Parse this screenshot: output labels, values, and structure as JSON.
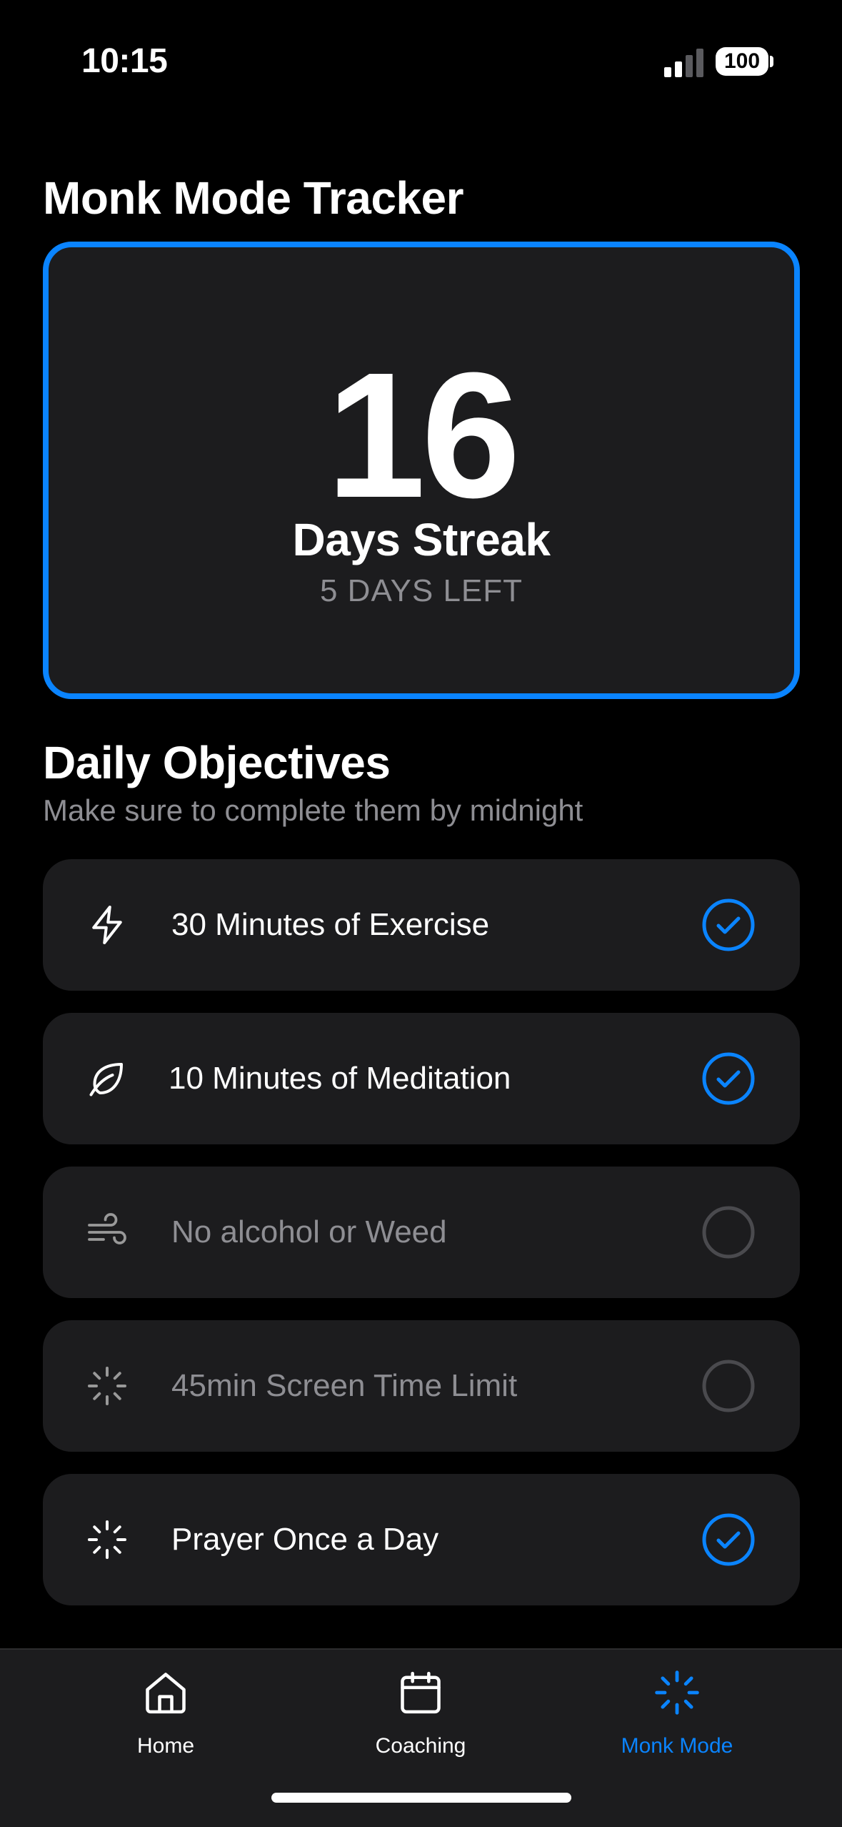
{
  "status_bar": {
    "time": "10:15",
    "battery": "100"
  },
  "page_title": "Monk Mode Tracker",
  "streak": {
    "count": "16",
    "label": "Days Streak",
    "remaining": "5 DAYS LEFT"
  },
  "objectives_section": {
    "title": "Daily Objectives",
    "subtitle": "Make sure to complete them by midnight"
  },
  "objectives": [
    {
      "label": "30 Minutes of Exercise",
      "icon": "bolt-icon",
      "completed": true
    },
    {
      "label": "10 Minutes of Meditation",
      "icon": "leaf-icon",
      "completed": true
    },
    {
      "label": "No alcohol or Weed",
      "icon": "wind-icon",
      "completed": false
    },
    {
      "label": "45min Screen Time Limit",
      "icon": "loader-icon",
      "completed": false
    },
    {
      "label": "Prayer Once a Day",
      "icon": "loader-icon",
      "completed": true
    }
  ],
  "tab_bar": {
    "tabs": [
      {
        "label": "Home",
        "icon": "home-icon",
        "active": false
      },
      {
        "label": "Coaching",
        "icon": "calendar-icon",
        "active": false
      },
      {
        "label": "Monk Mode",
        "icon": "loader-icon",
        "active": true
      }
    ]
  },
  "colors": {
    "accent": "#0a84ff",
    "card": "#1c1c1e",
    "muted": "#8e8e93",
    "background": "#000000"
  }
}
